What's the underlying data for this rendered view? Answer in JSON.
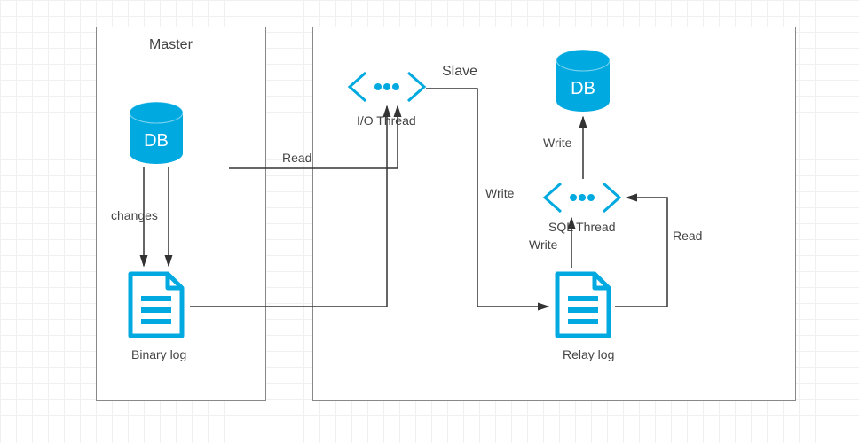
{
  "master": {
    "title": "Master",
    "db_label": "DB",
    "changes_label": "changes",
    "binary_log_label": "Binary log"
  },
  "slave": {
    "title": "Slave",
    "db_label": "DB",
    "io_thread_label": "I/O Thread",
    "sql_thread_label": "SQL Thread",
    "relay_log_label": "Relay log"
  },
  "edges": {
    "read_master_to_io": "Read",
    "write_io_to_relay": "Write",
    "write_relay_to_sql": "Write",
    "read_relay_to_sql": "Read",
    "write_sql_to_db": "Write"
  }
}
